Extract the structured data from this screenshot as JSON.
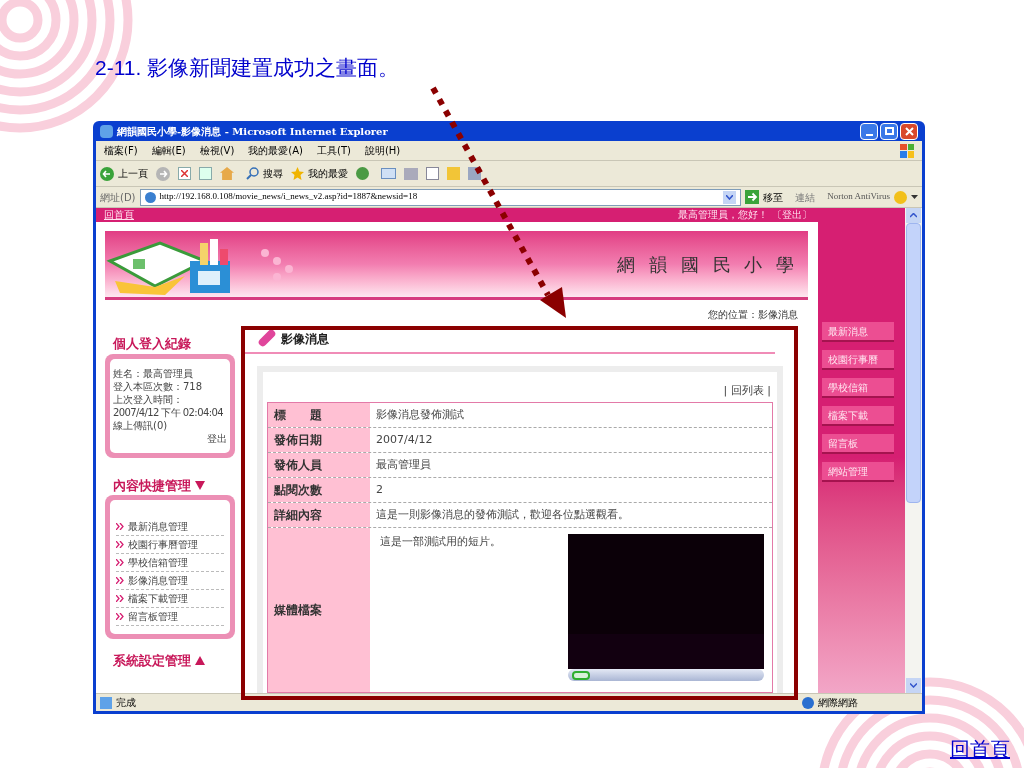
{
  "slide": {
    "title": "2-11. 影像新聞建置成功之畫面。",
    "home_link": "回首頁"
  },
  "window": {
    "title": "網韻國民小學-影像消息 - Microsoft Internet Explorer"
  },
  "menu": [
    "檔案(F)",
    "編輯(E)",
    "檢視(V)",
    "我的最愛(A)",
    "工具(T)",
    "說明(H)"
  ],
  "toolbar": {
    "back": "上一頁",
    "search": "搜尋",
    "favorites": "我的最愛"
  },
  "address_bar": {
    "label": "網址(D)",
    "url": "http://192.168.0.108/movie_news/i_news_v2.asp?id=1887&newsid=18",
    "go": "移至",
    "links": "連結",
    "norton": "Norton AntiVirus"
  },
  "page": {
    "top_link": "回首頁",
    "greeting": "最高管理員，您好！",
    "logout": "〔登出〕",
    "site_title": "網 韻 國 民 小 學",
    "breadcrumb": "您的位置：影像消息"
  },
  "login_box": {
    "title": "個人登入紀錄",
    "lines": [
      "姓名：最高管理員",
      "登入本區次數：718",
      "上次登入時間：",
      "2007/4/12 下午 02:04:04",
      "線上傳訊(0)"
    ],
    "logout": "登出"
  },
  "quick_box": {
    "title": "內容快捷管理",
    "items": [
      "最新消息管理",
      "校園行事曆管理",
      "學校信箱管理",
      "影像消息管理",
      "檔案下載管理",
      "留言板管理"
    ]
  },
  "system_box": {
    "title": "系統設定管理"
  },
  "news": {
    "header": "影像消息",
    "back_link": "| 回列表 |",
    "rows": [
      {
        "label": "標　　題",
        "value": "影像消息發佈測試"
      },
      {
        "label": "發佈日期",
        "value": "2007/4/12"
      },
      {
        "label": "發佈人員",
        "value": "最高管理員"
      },
      {
        "label": "點閱次數",
        "value": "2"
      },
      {
        "label": "詳細內容",
        "value": "這是一則影像消息的發佈測試，歡迎各位點選觀看。"
      }
    ],
    "media": {
      "label": "媒體檔案",
      "caption": "這是一部測試用的短片。"
    }
  },
  "right_menu": [
    "最新消息",
    "校園行事曆",
    "學校信箱",
    "檔案下載",
    "留言板",
    "網站管理"
  ],
  "status_bar": {
    "text": "完成",
    "zone": "網際網路"
  }
}
